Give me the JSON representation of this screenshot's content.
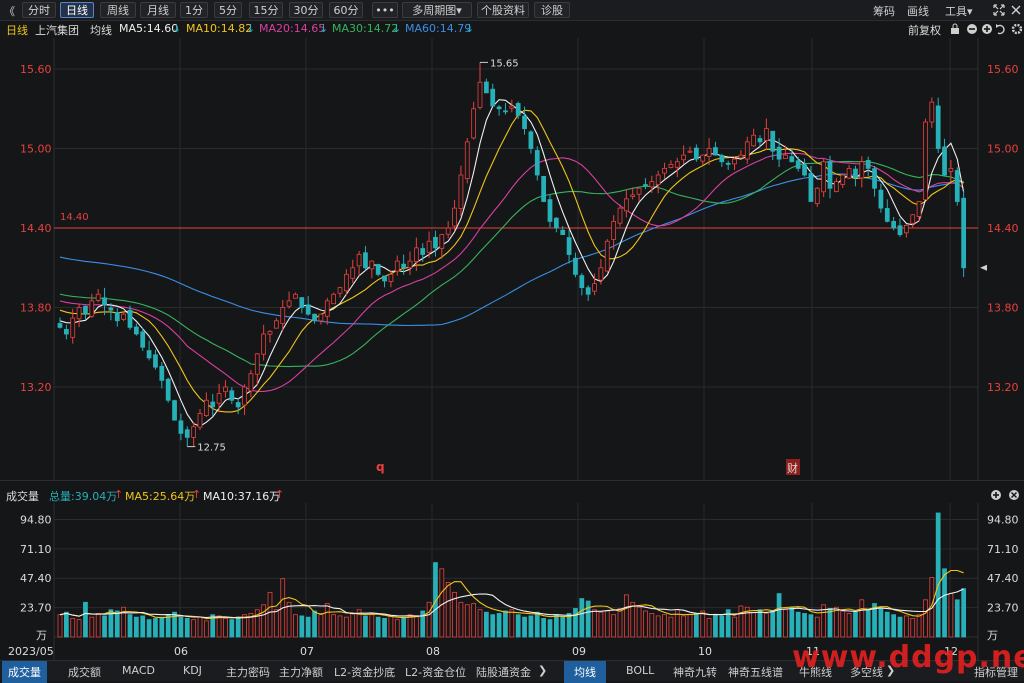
{
  "toolbar": {
    "collapse_label": "《",
    "periods": [
      "分时",
      "日线",
      "周线",
      "月线",
      "1分",
      "5分",
      "15分",
      "30分",
      "60分"
    ],
    "active_period": "日线",
    "more_label": "•••",
    "multi_label": "多周期图",
    "multi_arrow": "▾",
    "profile_label": "个股资料",
    "diagnose_label": "诊股",
    "chip_label": "筹码",
    "draw_label": "画线",
    "tools_label": "工具",
    "tools_arrow": "▾"
  },
  "ma_bar": {
    "period": "日线",
    "stock_name": "上汽集团",
    "avg_label": "均线",
    "ma5": "MA5:14.60",
    "ma10": "MA10:14.82",
    "ma20": "MA20:14.65",
    "ma30": "MA30:14.72",
    "ma60": "MA60:14.79",
    "adjust": "前复权"
  },
  "colors": {
    "up": "#e8413d",
    "down": "#27b0b8",
    "ma5": "#f0f0f0",
    "ma10": "#f0c419",
    "ma20": "#d93fa0",
    "ma30": "#36b35e",
    "ma60": "#3a8ee6",
    "grid": "#2a2b2f",
    "axis_text": "#e8413d"
  },
  "price_axis": {
    "ticks": [
      "15.60",
      "15.00",
      "14.40",
      "13.80",
      "13.20"
    ],
    "ref_label": "14.40",
    "high_label": "15.65",
    "low_label": "12.75"
  },
  "event_markers": {
    "dividend": "q",
    "finance": "财"
  },
  "x_axis": {
    "labels": [
      "2023/05",
      "06",
      "07",
      "08",
      "09",
      "10",
      "11",
      "12"
    ]
  },
  "volume_header": {
    "title": "成交量",
    "total": "总量:39.04万",
    "ma5": "MA5:25.64万",
    "ma10": "MA10:37.16万"
  },
  "volume_axis": {
    "ticks": [
      "94.80",
      "71.10",
      "47.40",
      "23.70"
    ],
    "unit": "万"
  },
  "bottom_tabs": {
    "left": [
      "成交量",
      "成交额",
      "MACD",
      "KDJ",
      "主力密码",
      "主力净额",
      "L2-资金抄底",
      "L2-资金仓位",
      "陆股通资金"
    ],
    "right": [
      "均线",
      "BOLL",
      "神奇九转",
      "神奇五线谱",
      "牛熊线",
      "多空线"
    ],
    "active_left": "成交量",
    "active_right": "均线",
    "manage_label": "指标管理"
  },
  "watermark": "www.ddgp.net",
  "chart_data": {
    "type": "candlestick",
    "title": "上汽集团 日线",
    "ylim": [
      12.6,
      15.8
    ],
    "volume_ylim": [
      0,
      100
    ],
    "volume_unit": "万",
    "month_labels": [
      "2023/05",
      "06",
      "07",
      "08",
      "09",
      "10",
      "11",
      "12"
    ],
    "series_close": [
      13.65,
      13.6,
      13.72,
      13.8,
      13.75,
      13.85,
      13.9,
      13.82,
      13.78,
      13.7,
      13.75,
      13.65,
      13.6,
      13.5,
      13.42,
      13.35,
      13.25,
      13.1,
      12.95,
      12.85,
      12.82,
      12.9,
      13.0,
      13.1,
      13.05,
      13.15,
      13.2,
      13.1,
      13.05,
      13.2,
      13.3,
      13.45,
      13.6,
      13.62,
      13.7,
      13.8,
      13.85,
      13.9,
      13.8,
      13.75,
      13.7,
      13.75,
      13.85,
      13.9,
      13.95,
      14.05,
      14.1,
      14.2,
      14.1,
      14.15,
      14.05,
      14.0,
      14.05,
      14.15,
      14.1,
      14.15,
      14.25,
      14.2,
      14.3,
      14.25,
      14.35,
      14.4,
      14.55,
      14.8,
      15.05,
      15.3,
      15.5,
      15.42,
      15.32,
      15.3,
      15.28,
      15.32,
      15.25,
      15.15,
      15.0,
      14.8,
      14.6,
      14.45,
      14.4,
      14.35,
      14.2,
      14.05,
      13.95,
      13.9,
      13.98,
      14.1,
      14.3,
      14.45,
      14.55,
      14.62,
      14.65,
      14.7,
      14.72,
      14.75,
      14.8,
      14.85,
      14.88,
      14.9,
      14.95,
      14.98,
      14.92,
      14.95,
      15.0,
      14.95,
      14.9,
      14.88,
      14.92,
      14.95,
      15.05,
      15.1,
      15.05,
      15.15,
      14.98,
      14.92,
      14.95,
      14.9,
      14.85,
      14.8,
      14.6,
      14.7,
      14.9,
      14.7,
      14.75,
      14.8,
      14.85,
      14.78,
      14.9,
      14.85,
      14.7,
      14.55,
      14.45,
      14.4,
      14.35,
      14.42,
      14.5,
      14.6,
      15.2,
      15.35,
      15.0,
      14.8,
      14.85,
      14.6,
      14.1
    ],
    "volume": [
      18,
      20,
      15,
      14,
      28,
      16,
      19,
      17,
      22,
      21,
      24,
      18,
      16,
      17,
      14,
      15,
      16,
      18,
      20,
      16,
      15,
      14,
      16,
      13,
      18,
      17,
      15,
      14,
      16,
      18,
      19,
      22,
      26,
      36,
      22,
      47,
      28,
      18,
      17,
      16,
      21,
      19,
      27,
      18,
      17,
      16,
      19,
      22,
      17,
      18,
      16,
      15,
      17,
      14,
      16,
      18,
      17,
      21,
      28,
      60,
      55,
      44,
      36,
      28,
      26,
      27,
      22,
      20,
      18,
      19,
      21,
      22,
      18,
      16,
      17,
      20,
      15,
      14,
      18,
      16,
      19,
      23,
      31,
      29,
      22,
      20,
      21,
      18,
      23,
      34,
      28,
      24,
      21,
      19,
      17,
      18,
      16,
      22,
      17,
      18,
      19,
      21,
      15,
      18,
      17,
      22,
      16,
      25,
      24,
      20,
      22,
      19,
      21,
      35,
      22,
      24,
      20,
      19,
      18,
      16,
      26,
      23,
      24,
      21,
      19,
      20,
      30,
      22,
      27,
      23,
      20,
      18,
      16,
      17,
      15,
      18,
      30,
      48,
      100,
      55,
      35,
      30,
      39
    ]
  }
}
